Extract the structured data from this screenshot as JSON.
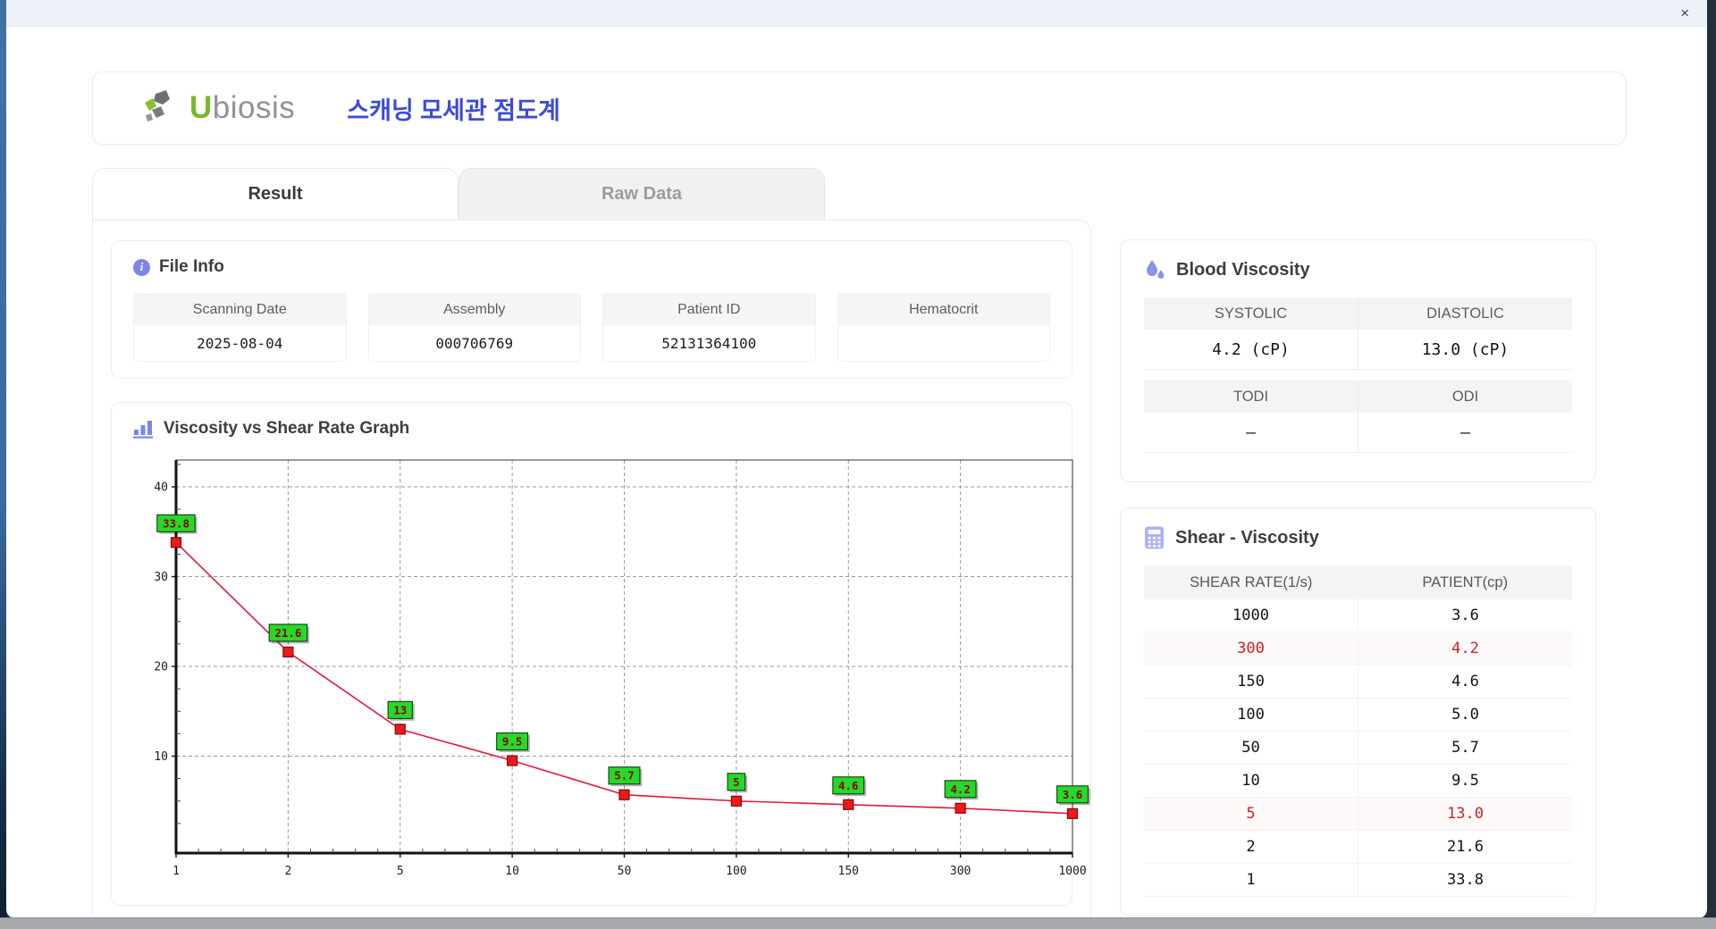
{
  "window": {
    "close_label": "×"
  },
  "header": {
    "logo_u": "U",
    "logo_rest": "biosis",
    "app_title_korean": "스캐닝 모세관 점도계"
  },
  "tabs": [
    {
      "label": "Result",
      "active": true
    },
    {
      "label": "Raw Data",
      "active": false
    }
  ],
  "file_info": {
    "title": "File Info",
    "fields": [
      {
        "label": "Scanning Date",
        "value": "2025-08-04"
      },
      {
        "label": "Assembly",
        "value": "000706769"
      },
      {
        "label": "Patient ID",
        "value": "52131364100"
      },
      {
        "label": "Hematocrit",
        "value": ""
      }
    ]
  },
  "blood_viscosity": {
    "title": "Blood Viscosity",
    "sections": [
      {
        "cells": [
          {
            "label": "SYSTOLIC",
            "value": "4.2 (cP)"
          },
          {
            "label": "DIASTOLIC",
            "value": "13.0 (cP)"
          }
        ]
      },
      {
        "cells": [
          {
            "label": "TODI",
            "value": "–"
          },
          {
            "label": "ODI",
            "value": "–"
          }
        ]
      }
    ]
  },
  "shear_viscosity": {
    "title": "Shear - Viscosity",
    "columns": [
      "SHEAR RATE(1/s)",
      "PATIENT(cp)"
    ],
    "rows": [
      {
        "shear": "1000",
        "patient": "3.6",
        "highlight": false
      },
      {
        "shear": "300",
        "patient": "4.2",
        "highlight": true
      },
      {
        "shear": "150",
        "patient": "4.6",
        "highlight": false
      },
      {
        "shear": "100",
        "patient": "5.0",
        "highlight": false
      },
      {
        "shear": "50",
        "patient": "5.7",
        "highlight": false
      },
      {
        "shear": "10",
        "patient": "9.5",
        "highlight": false
      },
      {
        "shear": "5",
        "patient": "13.0",
        "highlight": true
      },
      {
        "shear": "2",
        "patient": "21.6",
        "highlight": false
      },
      {
        "shear": "1",
        "patient": "33.8",
        "highlight": false
      }
    ]
  },
  "graph": {
    "title": "Viscosity vs Shear Rate Graph"
  },
  "chart_data": {
    "type": "line",
    "title": "Viscosity vs Shear Rate Graph",
    "x_scale": "categorical (shear rate steps, 1/s)",
    "categories": [
      1,
      2,
      5,
      10,
      50,
      100,
      150,
      300,
      1000
    ],
    "values": [
      33.8,
      21.6,
      13,
      9.5,
      5.7,
      5,
      4.6,
      4.2,
      3.6
    ],
    "point_labels": [
      "33.8",
      "21.6",
      "13",
      "9.5",
      "5.7",
      "5",
      "4.6",
      "4.2",
      "3.6"
    ],
    "xlabel": "",
    "ylabel": "",
    "ylim": [
      0,
      43
    ],
    "yticks": [
      10,
      20,
      30,
      40
    ],
    "grid": true,
    "grid_style": "dashed",
    "legend": "none",
    "line_color": "#e3173d",
    "marker_color": "#f01818",
    "marker_shape": "square",
    "label_bg_color": "#26d926",
    "label_text_color": "#8b0000"
  },
  "colors": {
    "accent_purple": "#7b86e8",
    "title_blue": "#3d4bd4",
    "logo_green": "#76b82a",
    "highlight_red": "#cc2222"
  }
}
